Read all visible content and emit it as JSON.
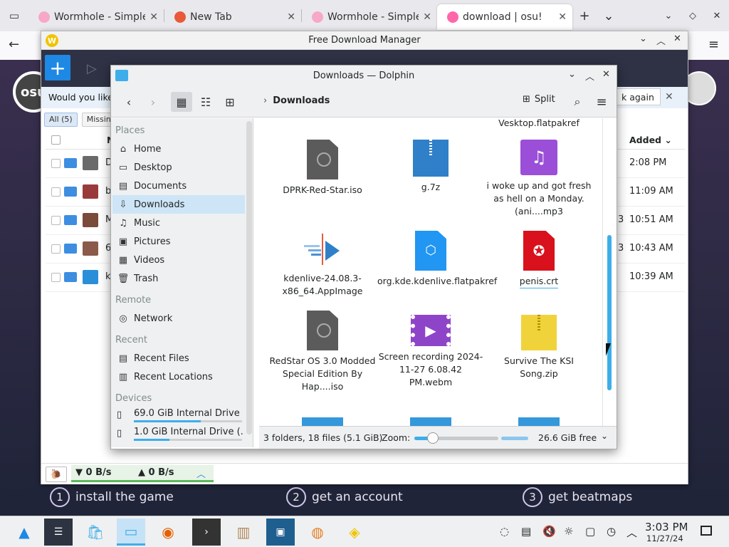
{
  "browser": {
    "tabs": [
      {
        "title": "Wormhole - Simple, p",
        "active": false
      },
      {
        "title": "New Tab",
        "active": false
      },
      {
        "title": "Wormhole - Simple, p",
        "active": false
      },
      {
        "title": "download | osu!",
        "active": true
      }
    ],
    "new_tab_label": "+",
    "tab_list_label": "⌄"
  },
  "osu_page": {
    "logo_text": "osu",
    "steps": [
      {
        "num": "1",
        "text": "install the game"
      },
      {
        "num": "2",
        "text": "get an account"
      },
      {
        "num": "3",
        "text": "get beatmaps"
      }
    ]
  },
  "fdm": {
    "title": "Free Download Manager",
    "add_label": "+",
    "banner_text": "Would you like t",
    "banner_btn": "k again",
    "filters": [
      {
        "label": "All (5)",
        "selected": true
      },
      {
        "label": "Missin",
        "selected": false
      }
    ],
    "header_name": "N",
    "header_added": "Added ⌄",
    "rows": [
      {
        "lead": "D",
        "side": "",
        "time": "2:08 PM"
      },
      {
        "lead": "b",
        "side": "",
        "time": "11:09 AM"
      },
      {
        "lead": "M",
        "side": "3",
        "time": "10:51 AM"
      },
      {
        "lead": "6",
        "side": "3",
        "time": "10:43 AM"
      },
      {
        "lead": "k",
        "side": "",
        "time": "10:39 AM"
      }
    ],
    "down_speed": "▼ 0 B/s",
    "up_speed": "▲ 0 B/s"
  },
  "dolphin": {
    "title": "Downloads — Dolphin",
    "breadcrumb": "Downloads",
    "split_label": "Split",
    "places": {
      "places_head": "Places",
      "items": [
        {
          "label": "Home",
          "icon": "⌂"
        },
        {
          "label": "Desktop",
          "icon": "▭"
        },
        {
          "label": "Documents",
          "icon": "▤"
        },
        {
          "label": "Downloads",
          "icon": "⇩"
        },
        {
          "label": "Music",
          "icon": "♫"
        },
        {
          "label": "Pictures",
          "icon": "▣"
        },
        {
          "label": "Videos",
          "icon": "▦"
        },
        {
          "label": "Trash",
          "icon": "🗑"
        }
      ],
      "remote_head": "Remote",
      "network": "Network",
      "recent_head": "Recent",
      "recent_files": "Recent Files",
      "recent_locations": "Recent Locations",
      "devices_head": "Devices",
      "drives": [
        {
          "label": "69.0 GiB Internal Drive ...",
          "used": 0.62
        },
        {
          "label": "1.0 GiB Internal Drive (...",
          "used": 0.33
        }
      ]
    },
    "files": [
      {
        "name": "Vesktop.flatpakref",
        "icon": "none"
      },
      {
        "name": "DPRK-Red-Star.iso",
        "icon": "disc"
      },
      {
        "name": "g.7z",
        "icon": "zip"
      },
      {
        "name": "i woke up and got fresh as hell on a Monday. (ani....mp3",
        "icon": "audio"
      },
      {
        "name": "kdenlive-24.08.3-x86_64.AppImage",
        "icon": "kden"
      },
      {
        "name": "org.kde.kdenlive.flatpakref",
        "icon": "flat"
      },
      {
        "name": "penis.crt",
        "icon": "cert"
      },
      {
        "name": "RedStar OS 3.0 Modded Special Edition By Hap....iso",
        "icon": "disc"
      },
      {
        "name": "Screen recording 2024-11-27 6.08.42 PM.webm",
        "icon": "video"
      },
      {
        "name": "Survive The KSI Song.zip",
        "icon": "yzip"
      }
    ],
    "status_count": "3 folders, 18 files (5.1 GiB)",
    "zoom_label": "Zoom:",
    "zoom_level": 0.22,
    "free_space": "26.6 GiB free"
  },
  "taskbar": {
    "time": "3:03 PM",
    "date": "11/27/24"
  },
  "colors": {
    "accent": "#3daee9",
    "fdm_blue": "#1e88e5",
    "fdm_dark": "#2f3245"
  }
}
